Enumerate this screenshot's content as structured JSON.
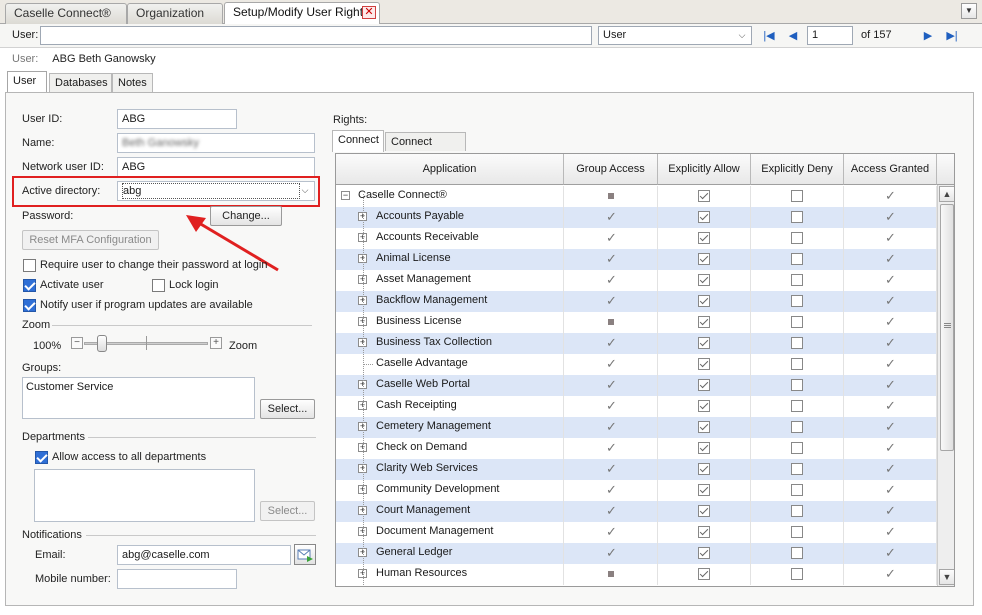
{
  "tabs": [
    {
      "label": "Caselle Connect®",
      "active": false
    },
    {
      "label": "Organization",
      "active": false
    },
    {
      "label": "Setup/Modify User Rights",
      "active": true
    }
  ],
  "close_glyph": "✕",
  "menu_glyph": "▼",
  "nav": {
    "user_label": "User:",
    "user_value": "",
    "type_select": "User",
    "record_number": "1",
    "record_total": "of 157",
    "first_glyph": "|◀",
    "prev_glyph": "◀",
    "next_glyph": "▶",
    "last_glyph": "▶|",
    "combo_glyph": "⌵"
  },
  "current_user": {
    "label": "User:",
    "value": "ABG  Beth Ganowsky"
  },
  "subtabs": [
    "User",
    "Databases",
    "Notes"
  ],
  "form": {
    "user_id_label": "User ID:",
    "user_id": "ABG",
    "name_label": "Name:",
    "name": "Beth Ganowsky",
    "network_label": "Network user ID:",
    "network_user_id": "ABG",
    "ad_label": "Active directory:",
    "ad_value": "abg",
    "password_label": "Password:",
    "change_button": "Change...",
    "reset_mfa_button": "Reset MFA Configuration",
    "require_change_label": "Require user to change their password at login",
    "require_change": false,
    "activate_label": "Activate user",
    "activate": true,
    "lock_label": "Lock login",
    "lock": false,
    "notify_label": "Notify user if program updates are available",
    "notify": true,
    "zoom_heading": "Zoom",
    "zoom_value": "100%",
    "zoom_level_percent": 100,
    "zoom_label": "Zoom",
    "zoom_minus": "−",
    "zoom_plus": "+",
    "groups_label": "Groups:",
    "groups": [
      "Customer Service"
    ],
    "groups_select_button": "Select...",
    "departments_heading": "Departments",
    "allow_all_departments_label": "Allow access to all departments",
    "allow_all_departments": true,
    "departments_select_button": "Select...",
    "notifications_heading": "Notifications",
    "email_label": "Email:",
    "email": "abg@caselle.com",
    "mobile_label": "Mobile number:",
    "mobile": ""
  },
  "rights": {
    "label": "Rights:",
    "tabs": [
      "Connect",
      "Connect Online"
    ],
    "columns": [
      "Application",
      "Group Access",
      "Explicitly Allow",
      "Explicitly Deny",
      "Access Granted"
    ],
    "root": {
      "name": "Caselle Connect®",
      "group": "square",
      "allow": true,
      "deny": false,
      "granted": true,
      "expander": "−"
    },
    "child_expander": "+",
    "check_glyph": "✓",
    "rows": [
      {
        "name": "Accounts Payable",
        "group": "check",
        "allow": true,
        "deny": false,
        "granted": true,
        "expandable": true
      },
      {
        "name": "Accounts Receivable",
        "group": "check",
        "allow": true,
        "deny": false,
        "granted": true,
        "expandable": true
      },
      {
        "name": "Animal License",
        "group": "check",
        "allow": true,
        "deny": false,
        "granted": true,
        "expandable": true
      },
      {
        "name": "Asset Management",
        "group": "check",
        "allow": true,
        "deny": false,
        "granted": true,
        "expandable": true
      },
      {
        "name": "Backflow Management",
        "group": "check",
        "allow": true,
        "deny": false,
        "granted": true,
        "expandable": true
      },
      {
        "name": "Business License",
        "group": "square",
        "allow": true,
        "deny": false,
        "granted": true,
        "expandable": true
      },
      {
        "name": "Business Tax Collection",
        "group": "check",
        "allow": true,
        "deny": false,
        "granted": true,
        "expandable": true
      },
      {
        "name": "Caselle Advantage",
        "group": "check",
        "allow": true,
        "deny": false,
        "granted": true,
        "expandable": false
      },
      {
        "name": "Caselle Web Portal",
        "group": "check",
        "allow": true,
        "deny": false,
        "granted": true,
        "expandable": true
      },
      {
        "name": "Cash Receipting",
        "group": "check",
        "allow": true,
        "deny": false,
        "granted": true,
        "expandable": true
      },
      {
        "name": "Cemetery Management",
        "group": "check",
        "allow": true,
        "deny": false,
        "granted": true,
        "expandable": true
      },
      {
        "name": "Check on Demand",
        "group": "check",
        "allow": true,
        "deny": false,
        "granted": true,
        "expandable": true
      },
      {
        "name": "Clarity Web Services",
        "group": "check",
        "allow": true,
        "deny": false,
        "granted": true,
        "expandable": true
      },
      {
        "name": "Community Development",
        "group": "check",
        "allow": true,
        "deny": false,
        "granted": true,
        "expandable": true
      },
      {
        "name": "Court Management",
        "group": "check",
        "allow": true,
        "deny": false,
        "granted": true,
        "expandable": true
      },
      {
        "name": "Document Management",
        "group": "check",
        "allow": true,
        "deny": false,
        "granted": true,
        "expandable": true
      },
      {
        "name": "General Ledger",
        "group": "check",
        "allow": true,
        "deny": false,
        "granted": true,
        "expandable": true
      },
      {
        "name": "Human Resources",
        "group": "square",
        "allow": true,
        "deny": false,
        "granted": true,
        "expandable": true
      }
    ],
    "scroll_up": "▲",
    "scroll_down": "▼"
  },
  "colors": {
    "highlight": "#e02020",
    "alt_row": "#dce6f7",
    "accent": "#2f6fd6"
  }
}
